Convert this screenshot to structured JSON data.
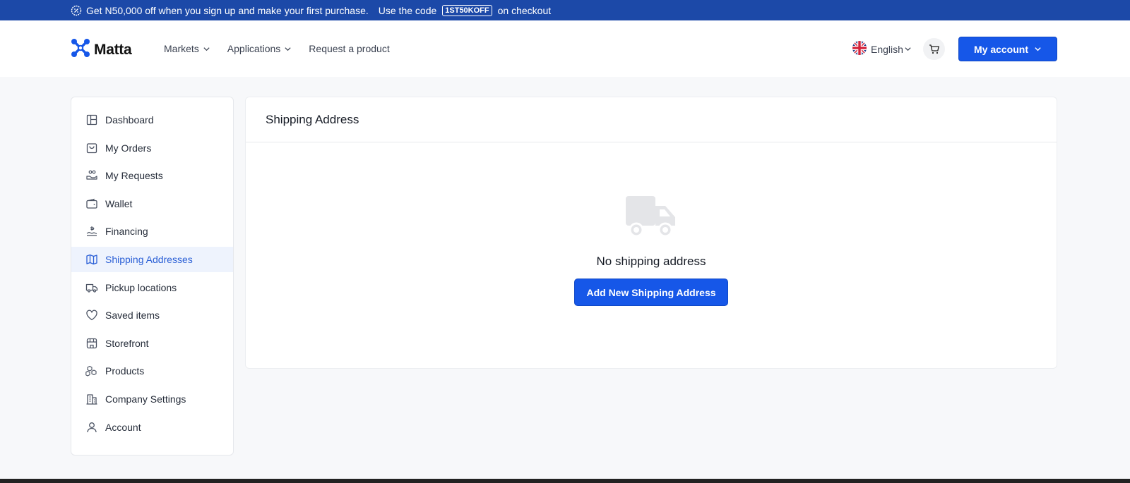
{
  "promo": {
    "text_before": "Get N50,000 off when you sign up and make your first purchase.",
    "use_code": "Use the code",
    "code": "1ST50KOFF",
    "text_after": "on checkout",
    "icon": "discount-badge-icon"
  },
  "header": {
    "logo_text": "Matta",
    "nav": [
      {
        "label": "Markets",
        "has_dropdown": true
      },
      {
        "label": "Applications",
        "has_dropdown": true
      },
      {
        "label": "Request a product",
        "has_dropdown": false
      }
    ],
    "language": "English",
    "account_button": "My account"
  },
  "sidebar": {
    "items": [
      {
        "label": "Dashboard",
        "icon": "dashboard-icon"
      },
      {
        "label": "My Orders",
        "icon": "shopping-bag-icon"
      },
      {
        "label": "My Requests",
        "icon": "requests-icon"
      },
      {
        "label": "Wallet",
        "icon": "wallet-icon"
      },
      {
        "label": "Financing",
        "icon": "financing-icon"
      },
      {
        "label": "Shipping Addresses",
        "icon": "map-icon",
        "active": true
      },
      {
        "label": "Pickup locations",
        "icon": "truck-icon"
      },
      {
        "label": "Saved items",
        "icon": "heart-icon"
      },
      {
        "label": "Storefront",
        "icon": "storefront-icon"
      },
      {
        "label": "Products",
        "icon": "boxes-icon"
      },
      {
        "label": "Company Settings",
        "icon": "building-icon"
      },
      {
        "label": "Account",
        "icon": "user-icon"
      }
    ]
  },
  "main": {
    "title": "Shipping Address",
    "empty_text": "No shipping address",
    "add_button": "Add New Shipping Address"
  },
  "colors": {
    "primary": "#1657e8",
    "promo_bar": "#1c49a8",
    "active_text": "#2a5fd6",
    "active_bg": "#eef3fd"
  }
}
